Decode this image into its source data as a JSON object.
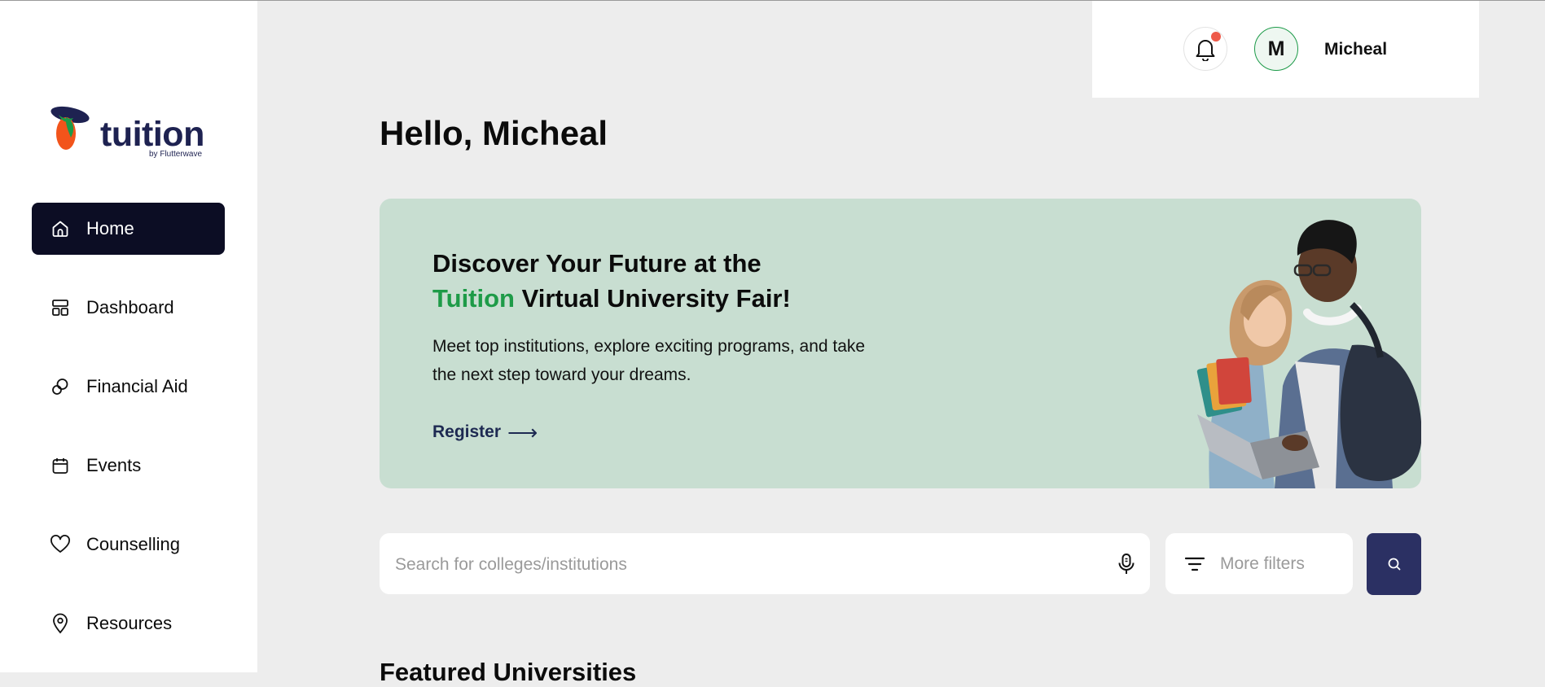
{
  "brand": {
    "name": "tuition",
    "byline": "by Flutterwave"
  },
  "sidebar": {
    "items": [
      {
        "label": "Home",
        "icon": "home-icon",
        "active": true
      },
      {
        "label": "Dashboard",
        "icon": "dashboard-icon"
      },
      {
        "label": "Financial Aid",
        "icon": "financial-aid-icon"
      },
      {
        "label": "Events",
        "icon": "calendar-icon"
      },
      {
        "label": "Counselling",
        "icon": "heart-icon"
      },
      {
        "label": "Resources",
        "icon": "location-pin-icon"
      }
    ]
  },
  "header": {
    "user_initial": "M",
    "user_name": "Micheal",
    "has_notification": true
  },
  "main": {
    "greeting": "Hello, Micheal",
    "banner": {
      "title_line1": "Discover Your Future at the",
      "title_accent": "Tuition",
      "title_line2_rest": " Virtual University Fair!",
      "description": "Meet top institutions, explore exciting programs, and take the next step toward your dreams.",
      "cta_label": "Register",
      "cta_arrow": "⟶"
    },
    "search": {
      "placeholder": "Search for colleges/institutions",
      "filters_label": "More filters"
    },
    "featured_title": "Featured Universities"
  },
  "colors": {
    "sidebar_active": "#0c0d24",
    "accent_green": "#1e9b48",
    "banner_bg": "#c8ded1",
    "search_button": "#2b3063",
    "notification_dot": "#ee5a4a"
  }
}
